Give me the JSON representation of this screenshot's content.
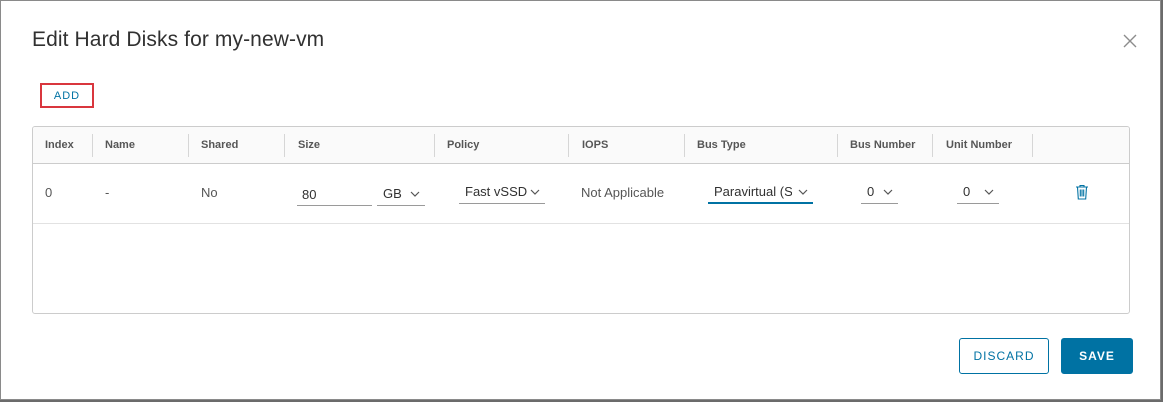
{
  "dialog": {
    "title": "Edit Hard Disks for my-new-vm",
    "add_label": "ADD",
    "discard_label": "DISCARD",
    "save_label": "SAVE"
  },
  "table": {
    "columns": [
      "Index",
      "Name",
      "Shared",
      "Size",
      "Policy",
      "IOPS",
      "Bus Type",
      "Bus Number",
      "Unit Number"
    ],
    "rows": [
      {
        "index": "0",
        "name": "-",
        "shared": "No",
        "size_value": "80",
        "size_unit": "GB",
        "policy": "Fast vSSD",
        "iops": "Not Applicable",
        "bus_type": "Paravirtual (SCSI)",
        "bus_number": "0",
        "unit_number": "0"
      }
    ]
  },
  "colors": {
    "accent": "#0072a3",
    "highlight_border": "#d9363e"
  },
  "icons": [
    "close-icon",
    "chevron-down-icon",
    "trash-icon"
  ]
}
